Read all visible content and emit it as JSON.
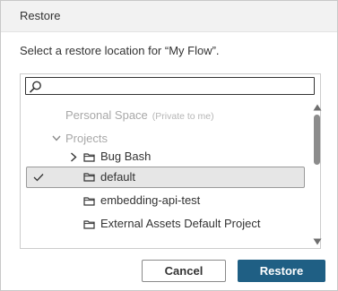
{
  "dialog": {
    "title": "Restore",
    "prompt": "Select a restore location for “My Flow”."
  },
  "search": {
    "value": "",
    "placeholder": ""
  },
  "tree": {
    "personal_space": {
      "label": "Personal Space",
      "hint": "(Private to me)"
    },
    "projects": {
      "label": "Projects"
    },
    "items": [
      {
        "label": "Bug Bash",
        "expandable": true,
        "selected": false
      },
      {
        "label": "default",
        "expandable": false,
        "selected": true
      },
      {
        "label": "embedding-api-test",
        "expandable": false,
        "selected": false
      },
      {
        "label": "External Assets Default Project",
        "expandable": false,
        "selected": false
      }
    ]
  },
  "buttons": {
    "cancel_label": "Cancel",
    "restore_label": "Restore"
  },
  "colors": {
    "primary": "#1f5f84",
    "selected_row": "#e6e6e6",
    "disabled_text": "#a8a8a8"
  },
  "icons": [
    "search-icon",
    "chevron-right-icon",
    "chevron-down-icon",
    "folder-icon",
    "checkmark-icon",
    "scroll-up-icon",
    "scroll-down-icon"
  ]
}
